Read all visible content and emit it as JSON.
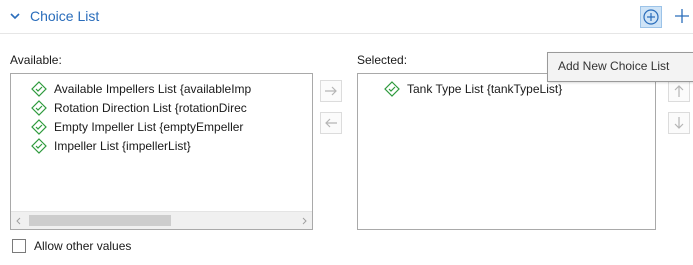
{
  "section": {
    "title": "Choice List",
    "add_button_icon": "add-circle-icon",
    "plus_button_icon": "plus-icon"
  },
  "available": {
    "label": "Available:",
    "items": [
      {
        "label": "Available Impellers List {availableImp",
        "icon": "choice-list-icon"
      },
      {
        "label": "Rotation Direction List {rotationDirec",
        "icon": "choice-list-icon"
      },
      {
        "label": "Empty Impeller List {emptyEmpeller",
        "icon": "choice-list-icon"
      },
      {
        "label": "Impeller List {impellerList}",
        "icon": "choice-list-icon"
      }
    ]
  },
  "selected": {
    "label": "Selected:",
    "items": [
      {
        "label": "Tank Type List {tankTypeList}",
        "icon": "choice-list-icon"
      }
    ]
  },
  "tooltip": {
    "text": "Add New Choice List"
  },
  "allow_other": {
    "label": "Allow other values",
    "checked": false
  },
  "colors": {
    "accent": "#2a6dbb",
    "icon_green": "#2e9a3d",
    "border": "#a9a9a9"
  }
}
